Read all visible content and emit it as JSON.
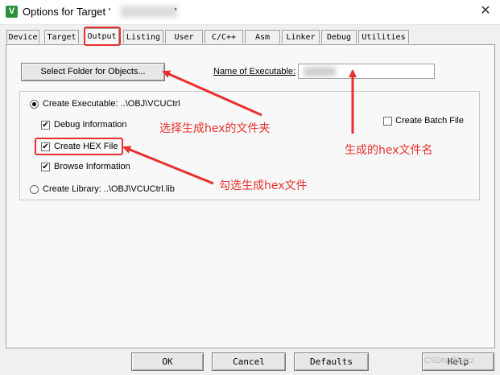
{
  "window": {
    "title_prefix": "Options for Target '",
    "title_suffix": "'",
    "close_glyph": "✕"
  },
  "tabs": [
    {
      "label": "Device"
    },
    {
      "label": "Target"
    },
    {
      "label": "Output"
    },
    {
      "label": "Listing"
    },
    {
      "label": "User"
    },
    {
      "label": "C/C++"
    },
    {
      "label": "Asm"
    },
    {
      "label": "Linker"
    },
    {
      "label": "Debug"
    },
    {
      "label": "Utilities"
    }
  ],
  "output": {
    "select_folder_label": "Select Folder for Objects...",
    "name_exec_label": "Name of Executable:",
    "create_exec_label": "Create Executable:  ..\\OBJ\\VCUCtrl",
    "debug_info_label": "Debug Information",
    "create_hex_label": "Create HEX File",
    "browse_info_label": "Browse Information",
    "create_lib_label": "Create Library:  ..\\OBJ\\VCUCtrl.lib",
    "create_batch_label": "Create Batch File",
    "check_glyph": "✔"
  },
  "annotations": {
    "a1": "选择生成hex的文件夹",
    "a2": "生成的hex文件名",
    "a3": "勾选生成hex文件"
  },
  "buttons": {
    "ok": "OK",
    "cancel": "Cancel",
    "defaults": "Defaults",
    "help": "Help"
  },
  "watermark": "CSDN @hjtzz",
  "colors": {
    "annotation_red": "#e8302e"
  }
}
